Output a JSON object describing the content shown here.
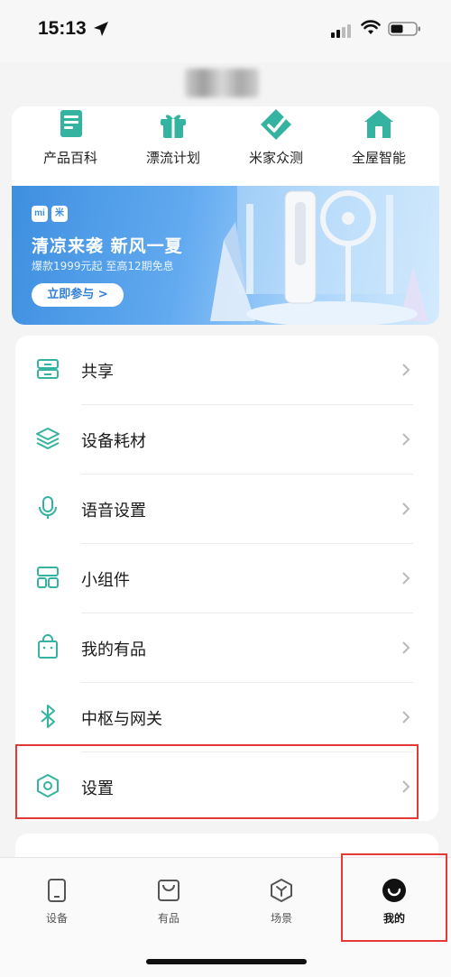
{
  "status_bar": {
    "time": "15:13"
  },
  "quick_entries": [
    {
      "label": "产品百科",
      "icon": "encyclopedia-icon"
    },
    {
      "label": "漂流计划",
      "icon": "gift-icon"
    },
    {
      "label": "米家众测",
      "icon": "test-tag-icon"
    },
    {
      "label": "全屋智能",
      "icon": "smart-home-icon"
    }
  ],
  "banner": {
    "logo_left": "mi",
    "logo_right": "米",
    "title": "清凉来袭 新风一夏",
    "subtitle": "爆款1999元起 至高12期免息",
    "button": "立即参与 >"
  },
  "menu": [
    {
      "label": "共享",
      "icon": "share-icon"
    },
    {
      "label": "设备耗材",
      "icon": "layers-icon"
    },
    {
      "label": "语音设置",
      "icon": "microphone-icon"
    },
    {
      "label": "小组件",
      "icon": "widget-icon"
    },
    {
      "label": "我的有品",
      "icon": "shopping-bag-icon"
    },
    {
      "label": "中枢与网关",
      "icon": "bluetooth-icon"
    },
    {
      "label": "设置",
      "icon": "hexagon-settings-icon"
    }
  ],
  "bottom_nav": [
    {
      "label": "设备",
      "icon": "device-icon",
      "active": false
    },
    {
      "label": "有品",
      "icon": "youpin-icon",
      "active": false
    },
    {
      "label": "场景",
      "icon": "scene-icon",
      "active": false
    },
    {
      "label": "我的",
      "icon": "profile-icon",
      "active": true
    }
  ],
  "colors": {
    "accent": "#34b3a0",
    "highlight": "#e53935"
  }
}
